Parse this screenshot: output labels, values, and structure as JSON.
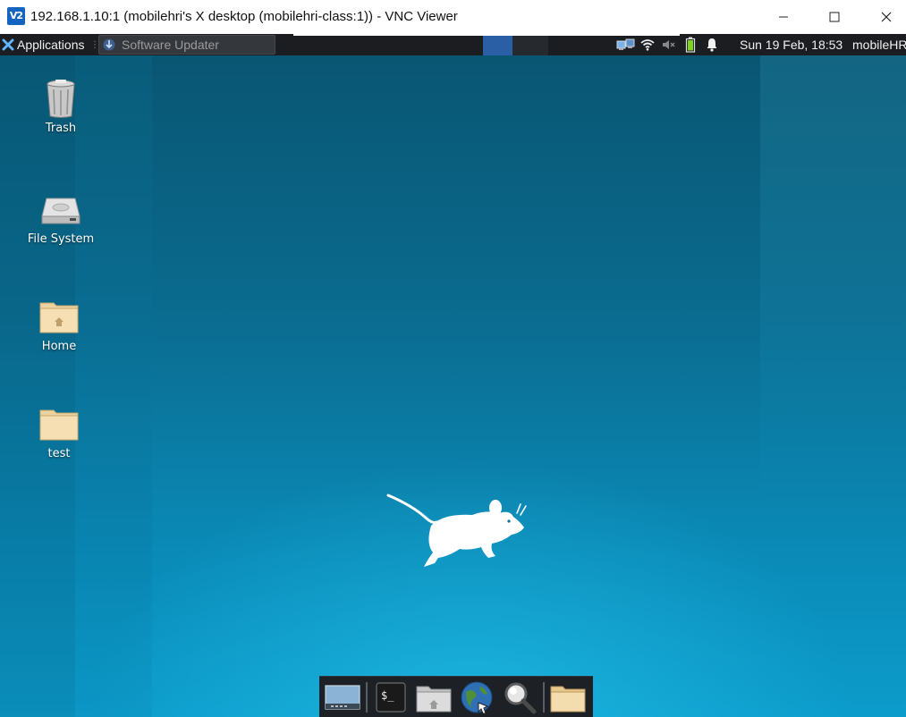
{
  "window": {
    "logo_text": "V2",
    "title": "192.168.1.10:1 (mobilehri's X desktop (mobilehri-class:1)) - VNC Viewer",
    "controls": [
      "minimize-icon",
      "maximize-icon",
      "close-icon"
    ]
  },
  "top_panel": {
    "applications_label": "Applications",
    "task_label": "Software Updater",
    "clock": "Sun 19 Feb, 18:53",
    "user": "mobileHR",
    "tray_icons": [
      "network-manager-icon",
      "wifi-icon",
      "volume-muted-icon",
      "battery-icon",
      "notification-bell-icon"
    ],
    "workspaces": [
      "workspace-1",
      "workspace-2"
    ],
    "active_workspace": 1
  },
  "desktop": {
    "icons": [
      {
        "label": "Trash",
        "icon": "trash-icon"
      },
      {
        "label": "File System",
        "icon": "hard-drive-icon"
      },
      {
        "label": "Home",
        "icon": "home-folder-icon"
      },
      {
        "label": "test",
        "icon": "folder-icon"
      }
    ]
  },
  "dock": {
    "items": [
      "show-desktop-icon",
      "terminal-icon",
      "home-folder-icon",
      "web-browser-icon",
      "search-icon",
      "file-manager-icon"
    ],
    "terminal_prompt": "$_"
  },
  "colors": {
    "accent": "#2a5fa5",
    "panel": "#1b1d21",
    "desktop_top": "#0a5f7d",
    "desktop_bottom": "#0c9ccb"
  }
}
